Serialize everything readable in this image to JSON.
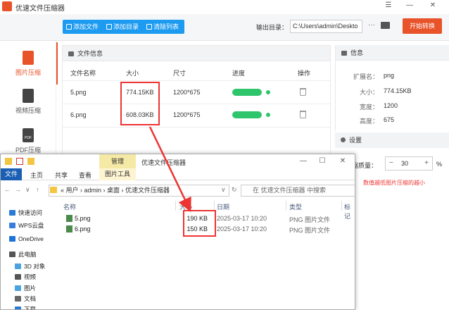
{
  "app": {
    "title": "优速文件压缩器",
    "window_controls": [
      "☰",
      "—",
      "✕"
    ]
  },
  "toolbar": {
    "add_file": "添加文件",
    "add_dir": "添加目录",
    "clear_list": "清除列表",
    "output_label": "输出目录：",
    "output_path": "C:\\Users\\admin\\Deskto",
    "more": "···",
    "start": "开始转换"
  },
  "sidebar": {
    "items": [
      {
        "label": "图片压缩",
        "icon": "image-icon",
        "active": true
      },
      {
        "label": "视频压缩",
        "icon": "video-icon",
        "active": false
      },
      {
        "label": "PDF压缩",
        "icon": "pdf-icon",
        "icon_text": "PDF",
        "active": false
      }
    ]
  },
  "filepanel": {
    "title": "文件信息",
    "columns": [
      "文件名称",
      "大小",
      "尺寸",
      "进度",
      "操作"
    ],
    "rows": [
      {
        "name": "5.png",
        "size": "774.15KB",
        "dims": "1200*675",
        "progress": 1.0
      },
      {
        "name": "6.png",
        "size": "608.03KB",
        "dims": "1200*675",
        "progress": 1.0
      }
    ]
  },
  "info": {
    "title": "信息",
    "fields": [
      {
        "label": "扩展名：",
        "value": "png"
      },
      {
        "label": "大小：",
        "value": "774.15KB"
      },
      {
        "label": "宽度：",
        "value": "1200"
      },
      {
        "label": "高度：",
        "value": "675"
      }
    ]
  },
  "settings": {
    "title": "设置",
    "quality_label": "缩质量：",
    "quality_value": "30",
    "minus": "−",
    "plus": "+",
    "pct": "%",
    "hint": "数值越低图片压缩的越小"
  },
  "explorer": {
    "manage_tab": "管理",
    "title": "优速文件压缩器",
    "window_controls": [
      "—",
      "☐",
      "✕"
    ],
    "ribbon": [
      "文件",
      "主页",
      "共享",
      "查看",
      "图片工具"
    ],
    "nav": {
      "back": "←",
      "forward": "→",
      "down": "∨",
      "up": "↑",
      "refresh": "↻",
      "dropdown": "∨"
    },
    "address": "«  用户  ›  admin  ›  桌面  ›  优速文件压缩器",
    "search_placeholder": "在 优速文件压缩器 中搜索",
    "tree": [
      {
        "label": "快速访问",
        "color": "#2a7bd6"
      },
      {
        "label": "WPS云盘",
        "color": "#3b7ddd"
      },
      {
        "label": "OneDrive",
        "color": "#1e73d8"
      },
      {
        "label": "此电脑",
        "color": "#555555"
      },
      {
        "label": "3D 对象",
        "color": "#4aa3df"
      },
      {
        "label": "视频",
        "color": "#555555"
      },
      {
        "label": "图片",
        "color": "#4aa3df"
      },
      {
        "label": "文档",
        "color": "#666666"
      },
      {
        "label": "下载",
        "color": "#2a7bd6"
      }
    ],
    "columns": [
      "名称",
      "大小",
      "日期",
      "类型",
      "标记"
    ],
    "files": [
      {
        "name": "5.png",
        "size": "190 KB",
        "date": "2025-03-17 10:20",
        "type": "PNG 图片文件"
      },
      {
        "name": "6.png",
        "size": "150 KB",
        "date": "2025-03-17 10:20",
        "type": "PNG 图片文件"
      }
    ]
  },
  "colors": {
    "accent": "#e8532a",
    "toolbar_blue": "#1d9bf0",
    "progress_green": "#2ec56b",
    "highlight_red": "#e33333"
  }
}
